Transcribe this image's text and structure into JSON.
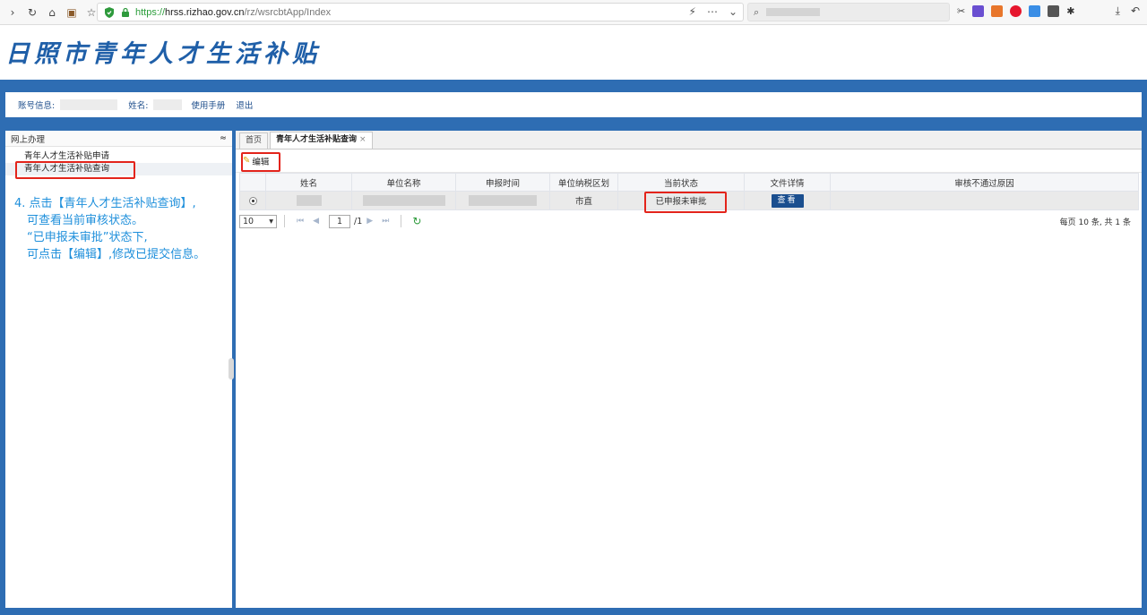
{
  "browser": {
    "url_scheme": "https://",
    "url_host": "hrss.rizhao.gov.cn",
    "url_path": "/rz/wsrcbtApp/Index",
    "menu_icon": "⋯"
  },
  "site_title": "日照市青年人才生活补贴",
  "userbar": {
    "account_label": "账号信息:",
    "name_label": "姓名:",
    "manual_link": "使用手册",
    "logout_link": "退出"
  },
  "sidebar": {
    "header": "网上办理",
    "collapse_icon": "≈",
    "items": [
      {
        "label": "青年人才生活补贴申请"
      },
      {
        "label": "青年人才生活补贴查询"
      }
    ]
  },
  "annotation": {
    "line1": "4. 点击【青年人才生活补贴查询】,",
    "line2": "可查看当前审核状态。",
    "line3": "“已申报未审批”状态下,",
    "line4": "可点击【编辑】,修改已提交信息。"
  },
  "tabs": [
    {
      "label": "首页"
    },
    {
      "label": "青年人才生活补贴查询",
      "close": "×"
    }
  ],
  "toolbar": {
    "edit_label": "编辑"
  },
  "table": {
    "columns": [
      "姓名",
      "单位名称",
      "申报时间",
      "单位纳税区划",
      "当前状态",
      "文件详情",
      "审核不通过原因"
    ],
    "rows": [
      {
        "district": "市直",
        "status": "已申报未审批",
        "action": "查看",
        "reason": ""
      }
    ]
  },
  "pager": {
    "page_size": "10",
    "page_input": "1",
    "page_total": "/1",
    "info": "每页 10 条, 共 1 条"
  }
}
